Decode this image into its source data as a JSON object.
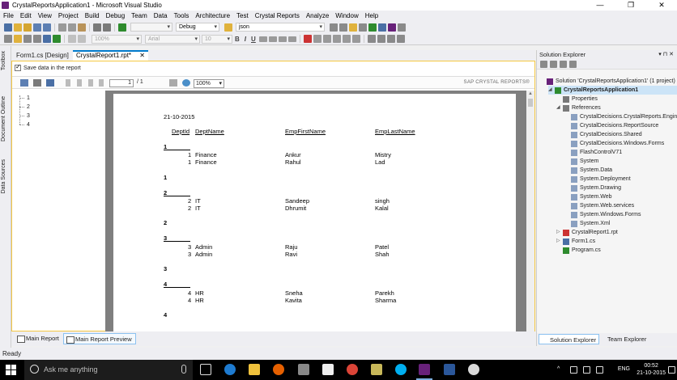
{
  "window": {
    "title": "CrystalReportsApplication1 - Microsoft Visual Studio"
  },
  "menu": [
    "File",
    "Edit",
    "View",
    "Project",
    "Build",
    "Debug",
    "Team",
    "Data",
    "Tools",
    "Architecture",
    "Test",
    "Crystal Reports",
    "Analyze",
    "Window",
    "Help"
  ],
  "toolbar": {
    "config": "Debug",
    "search_combo": "json",
    "zoom_combo": "100%",
    "font_combo": "Arial",
    "size_combo": "10",
    "bold": "B",
    "italic": "I",
    "underline": "U",
    "icon_colors": {
      "primary": "#68217a",
      "accent": "#007acc",
      "green": "#2e8b2e",
      "yellow": "#e0b23c"
    }
  },
  "left_strip": {
    "toolbox": "Toolbox",
    "document_outline": "Document Outline",
    "data_sources": "Data Sources"
  },
  "doc_tabs": [
    {
      "label": "Form1.cs [Design]"
    },
    {
      "label": "CrystalReport1.rpt*",
      "close": "✕"
    }
  ],
  "report_viewer": {
    "save_data_label": "Save data in the report",
    "page_current": "1",
    "page_total": "/ 1",
    "zoom": "100%",
    "brand": "SAP CRYSTAL REPORTS®",
    "tree": [
      "1",
      "2",
      "3",
      "4"
    ]
  },
  "report": {
    "date": "21-10-2015",
    "headers": [
      "DeptId",
      "DeptName",
      "EmpFirstName",
      "EmpLastName"
    ],
    "groups": [
      {
        "id": "1",
        "rows": [
          [
            "1",
            "Finance",
            "Ankur",
            "Mistry"
          ],
          [
            "1",
            "Finance",
            "Rahul",
            "Lad"
          ]
        ]
      },
      {
        "id": "2",
        "rows": [
          [
            "2",
            "IT",
            "Sandeep",
            "singh"
          ],
          [
            "2",
            "IT",
            "Dhrumit",
            "Kalal"
          ]
        ]
      },
      {
        "id": "3",
        "rows": [
          [
            "3",
            "Admin",
            "Raju",
            "Patel"
          ],
          [
            "3",
            "Admin",
            "Ravi",
            "Shah"
          ]
        ]
      },
      {
        "id": "4",
        "rows": [
          [
            "4",
            "HR",
            "Sneha",
            "Parekh"
          ],
          [
            "4",
            "HR",
            "Kavita",
            "Sharma"
          ]
        ]
      }
    ]
  },
  "bottom_tabs": [
    "Main Report",
    "Main Report Preview"
  ],
  "solution_explorer": {
    "title": "Solution Explorer",
    "pin": "▾ ⊓ ✕",
    "items": [
      {
        "label": "Solution 'CrystalReportsApplication1' (1 project)",
        "level": 0,
        "icon": "solution-icon"
      },
      {
        "label": "CrystalReportsApplication1",
        "level": 1,
        "icon": "csharp-project-icon",
        "bold": true
      },
      {
        "label": "Properties",
        "level": 2,
        "icon": "wrench-icon"
      },
      {
        "label": "References",
        "level": 2,
        "icon": "references-icon"
      },
      {
        "label": "CrystalDecisions.CrystalReports.Engine",
        "level": 3,
        "icon": "reference-icon"
      },
      {
        "label": "CrystalDecisions.ReportSource",
        "level": 3,
        "icon": "reference-icon"
      },
      {
        "label": "CrystalDecisions.Shared",
        "level": 3,
        "icon": "reference-icon"
      },
      {
        "label": "CrystalDecisions.Windows.Forms",
        "level": 3,
        "icon": "reference-icon"
      },
      {
        "label": "FlashControlV71",
        "level": 3,
        "icon": "reference-icon"
      },
      {
        "label": "System",
        "level": 3,
        "icon": "reference-icon"
      },
      {
        "label": "System.Data",
        "level": 3,
        "icon": "reference-icon"
      },
      {
        "label": "System.Deployment",
        "level": 3,
        "icon": "reference-icon"
      },
      {
        "label": "System.Drawing",
        "level": 3,
        "icon": "reference-icon"
      },
      {
        "label": "System.Web",
        "level": 3,
        "icon": "reference-icon"
      },
      {
        "label": "System.Web.services",
        "level": 3,
        "icon": "reference-icon"
      },
      {
        "label": "System.Windows.Forms",
        "level": 3,
        "icon": "reference-icon"
      },
      {
        "label": "System.Xml",
        "level": 3,
        "icon": "reference-icon"
      },
      {
        "label": "CrystalReport1.rpt",
        "level": 2,
        "icon": "crystal-report-file-icon"
      },
      {
        "label": "Form1.cs",
        "level": 2,
        "icon": "form-file-icon"
      },
      {
        "label": "Program.cs",
        "level": 2,
        "icon": "csharp-file-icon"
      }
    ],
    "tabs": [
      "Solution Explorer",
      "Team Explorer"
    ]
  },
  "status": "Ready",
  "taskbar": {
    "search_placeholder": "Ask me anything",
    "language": "ENG",
    "time": "00:52",
    "date": "21-10-2015"
  }
}
